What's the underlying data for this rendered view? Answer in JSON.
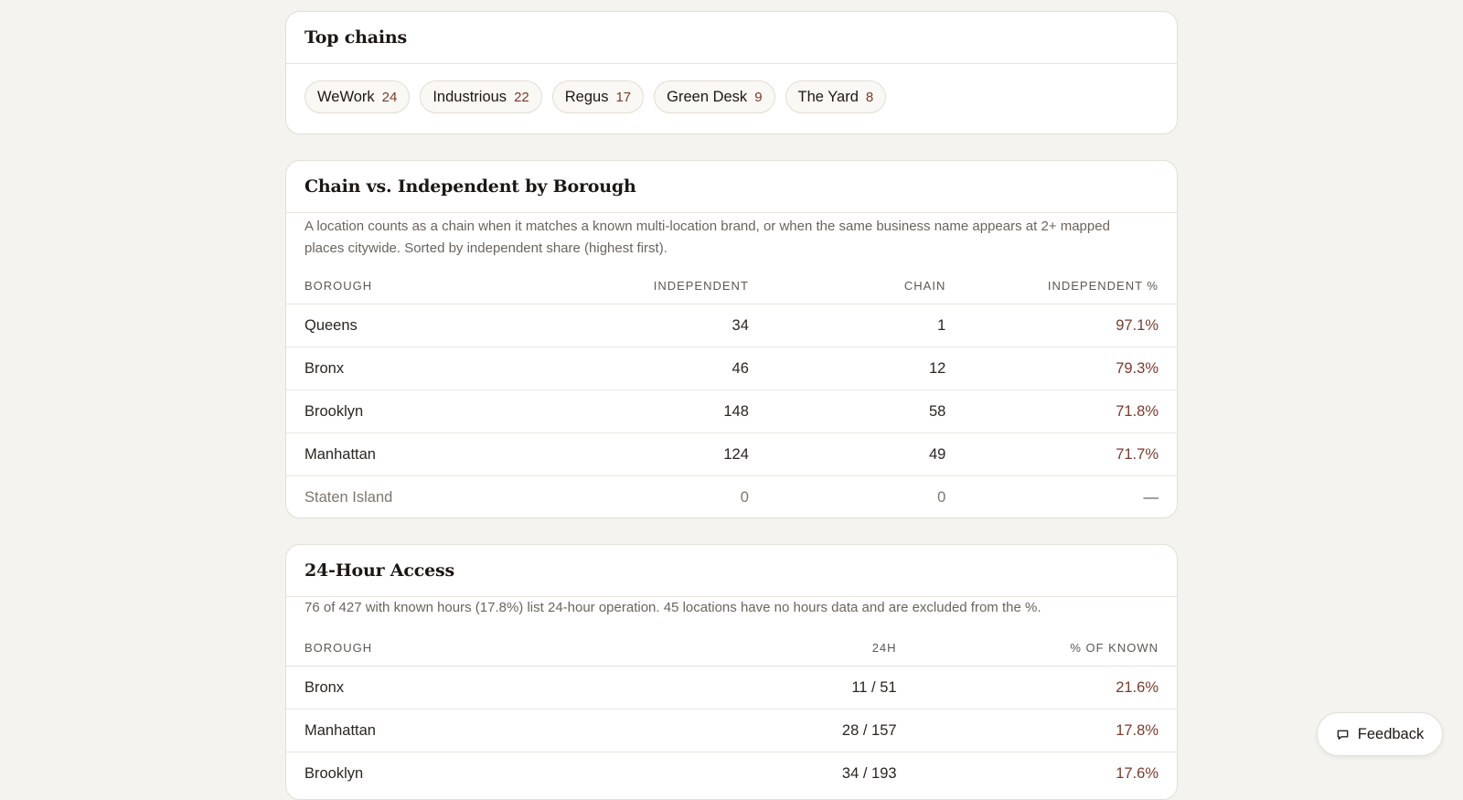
{
  "top_chains": {
    "title": "Top chains",
    "chips": [
      {
        "name": "WeWork",
        "count": "24"
      },
      {
        "name": "Industrious",
        "count": "22"
      },
      {
        "name": "Regus",
        "count": "17"
      },
      {
        "name": "Green Desk",
        "count": "9"
      },
      {
        "name": "The Yard",
        "count": "8"
      }
    ]
  },
  "chain_vs_independent": {
    "title": "Chain vs. Independent by Borough",
    "description": "A location counts as a chain when it matches a known multi-location brand, or when the same business name appears at 2+ mapped places citywide. Sorted by independent share (highest first).",
    "headers": [
      "Borough",
      "Independent",
      "Chain",
      "Independent %"
    ],
    "rows": [
      [
        "Queens",
        "34",
        "1",
        "97.1%"
      ],
      [
        "Bronx",
        "46",
        "12",
        "79.3%"
      ],
      [
        "Brooklyn",
        "148",
        "58",
        "71.8%"
      ],
      [
        "Manhattan",
        "124",
        "49",
        "71.7%"
      ],
      [
        "Staten Island",
        "0",
        "0",
        "—"
      ]
    ]
  },
  "access_24h": {
    "title": "24-Hour Access",
    "description": "76 of 427 with known hours (17.8%) list 24-hour operation. 45 locations have no hours data and are excluded from the %.",
    "headers": [
      "Borough",
      "24h",
      "% of known"
    ],
    "rows": [
      [
        "Bronx",
        "11 / 51",
        "21.6%"
      ],
      [
        "Manhattan",
        "28 / 157",
        "17.8%"
      ],
      [
        "Brooklyn",
        "34 / 193",
        "17.6%"
      ]
    ]
  },
  "feedback": {
    "label": "Feedback",
    "icon": "chat-bubble-icon"
  },
  "colors": {
    "accent": "#7a3b2c",
    "background": "#f4f3ef",
    "card": "#ffffff"
  }
}
